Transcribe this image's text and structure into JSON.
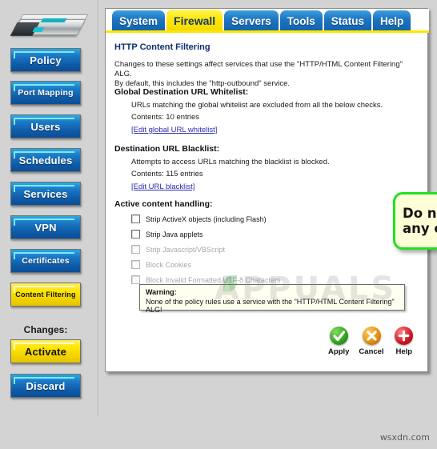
{
  "sidebar": {
    "logo_alt": "network-appliance-device",
    "buttons": [
      {
        "label": "Policy",
        "style": "blue",
        "size": "fs13"
      },
      {
        "label": "Port Mapping",
        "style": "blue",
        "size": "fs11"
      },
      {
        "label": "Users",
        "style": "blue",
        "size": "fs13"
      },
      {
        "label": "Schedules",
        "style": "blue",
        "size": "fs13"
      },
      {
        "label": "Services",
        "style": "blue",
        "size": "fs13"
      },
      {
        "label": "VPN",
        "style": "blue",
        "size": "fs13"
      },
      {
        "label": "Certificates",
        "style": "blue",
        "size": "fs11"
      },
      {
        "label": "Content Filtering",
        "style": "yellow",
        "size": "fs9"
      }
    ],
    "changes_label": "Changes:",
    "activate_label": "Activate",
    "discard_label": "Discard"
  },
  "tabs": [
    {
      "label": "System",
      "active": false
    },
    {
      "label": "Firewall",
      "active": true
    },
    {
      "label": "Servers",
      "active": false
    },
    {
      "label": "Tools",
      "active": false
    },
    {
      "label": "Status",
      "active": false
    },
    {
      "label": "Help",
      "active": false
    }
  ],
  "page": {
    "title": "HTTP Content Filtering",
    "intro_line1": "Changes to these settings affect services that use the \"HTTP/HTML Content Filtering\" ALG.",
    "intro_line2": "By default, this includes the \"http-outbound\" service.",
    "whitelist": {
      "heading": "Global Destination URL Whitelist:",
      "description": "URLs matching the global whitelist are excluded from all the below checks.",
      "contents": "Contents: 10 entries",
      "link": "[Edit global URL whitelist]"
    },
    "blacklist": {
      "heading": "Destination URL Blacklist:",
      "description": "Attempts to access URLs matching the blacklist is blocked.",
      "contents": "Contents: 115 entries",
      "link": "[Edit URL blacklist]"
    },
    "active_content": {
      "heading": "Active content handling:",
      "checkboxes": [
        {
          "label": "Strip ActiveX objects (including Flash)",
          "checked": false,
          "disabled": false
        },
        {
          "label": "Strip Java applets",
          "checked": false,
          "disabled": false
        },
        {
          "label": "Strip Javascript/VBScript",
          "checked": false,
          "disabled": true
        },
        {
          "label": "Block Cookies",
          "checked": false,
          "disabled": true
        },
        {
          "label": "Block Invalid Formatted UTF-8 Characters",
          "checked": false,
          "disabled": true
        }
      ]
    },
    "warning": {
      "title": "Warning:",
      "body": "None of the policy rules use a service with the \"HTTP/HTML Content Filtering\" ALG!"
    },
    "actions": [
      {
        "label": "Apply",
        "icon": "check-circle-icon",
        "color": "#2f9e1f"
      },
      {
        "label": "Cancel",
        "icon": "x-circle-icon",
        "color": "#e08a10"
      },
      {
        "label": "Help",
        "icon": "plus-circle-icon",
        "color": "#cc1622"
      }
    ]
  },
  "annotation": {
    "text_line1": "Do not block",
    "text_line2": "any content",
    "border_color": "#22e022",
    "fill_color": "#feffd6"
  },
  "watermarks": {
    "center": "APPUALS",
    "corner": "wsxdn.com"
  }
}
